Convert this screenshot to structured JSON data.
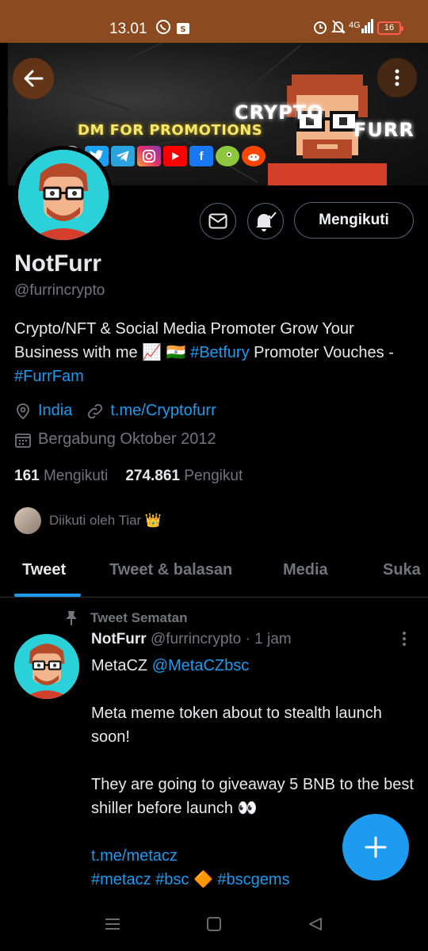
{
  "statusbar": {
    "time": "13.01",
    "network": "4G",
    "battery": "16"
  },
  "banner": {
    "promo_text": "DM FOR PROMOTIONS",
    "brand_line1": "CRYPTO",
    "brand_line2": "FURR",
    "social_icons": [
      "coinmarketcap-icon",
      "twitter-icon",
      "telegram-icon",
      "instagram-icon",
      "youtube-icon",
      "facebook-icon",
      "coingecko-icon",
      "reddit-icon"
    ]
  },
  "profile": {
    "name": "NotFurr",
    "handle": "@furrincrypto",
    "follow_label": "Mengikuti",
    "bio_part1": "Crypto/NFT & Social Media Promoter Grow Your Business with me 📈 🇮🇳 ",
    "bio_tag1": "#Betfury",
    "bio_part2": " Promoter Vouches - ",
    "bio_tag2": "#FurrFam",
    "location": "India",
    "website": "t.me/Cryptofurr",
    "joined": "Bergabung Oktober 2012",
    "following_count": "161",
    "following_label": "Mengikuti",
    "followers_count": "274.861",
    "followers_label": "Pengikut",
    "followed_by": "Diikuti oleh Tiar 👑"
  },
  "tabs": [
    "Tweet",
    "Tweet & balasan",
    "Media",
    "Suka"
  ],
  "tweet": {
    "pinned_label": "Tweet Sematan",
    "author": "NotFurr",
    "handle": "@furrincrypto",
    "time": "· 1 jam",
    "line1_text": "MetaCZ ",
    "line1_mention": "@MetaCZbsc",
    "para1": "Meta meme token about to stealth launch soon!",
    "para2": "They are going to giveaway 5 BNB to the best shiller before launch 👀",
    "link": "t.me/metacz",
    "hashtags": "#metacz #bsc 🔶 #bscgems"
  },
  "colors": {
    "accent": "#1d9bf0",
    "statusbar": "#8b4a1f",
    "avatar_bg": "#2ad1d8"
  }
}
